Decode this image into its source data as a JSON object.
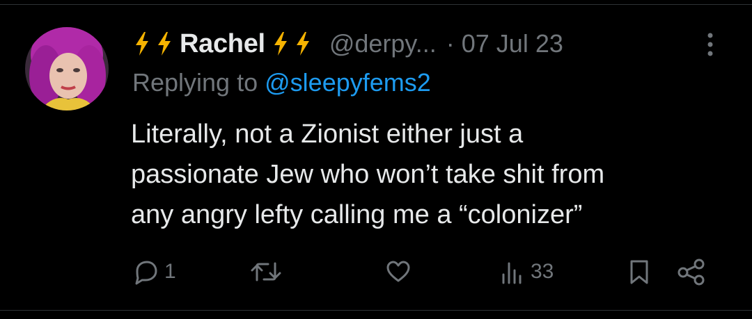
{
  "tweet": {
    "display_name": "Rachel",
    "name_emoji": "⚡",
    "handle": "@derpy...",
    "separator": "·",
    "date": "07 Jul 23",
    "reply_prefix": "Replying to",
    "reply_to": "@sleepyfems2",
    "body_lines": [
      "Literally, not a Zionist either just a",
      "passionate Jew who won’t take shit from",
      "any angry lefty calling me a “colonizer”"
    ],
    "actions": {
      "reply_count": "1",
      "retweet_count": "",
      "like_count": "",
      "views_count": "33"
    }
  },
  "colors": {
    "background": "#000000",
    "text_primary": "#e7e9ea",
    "text_secondary": "#71767b",
    "link": "#1d9bf0",
    "bolt": "#f5b301",
    "divider": "#2f3336"
  },
  "icons": [
    "lightning-icon",
    "more-icon",
    "reply-icon",
    "retweet-icon",
    "like-icon",
    "views-icon",
    "bookmark-icon",
    "share-icon"
  ]
}
